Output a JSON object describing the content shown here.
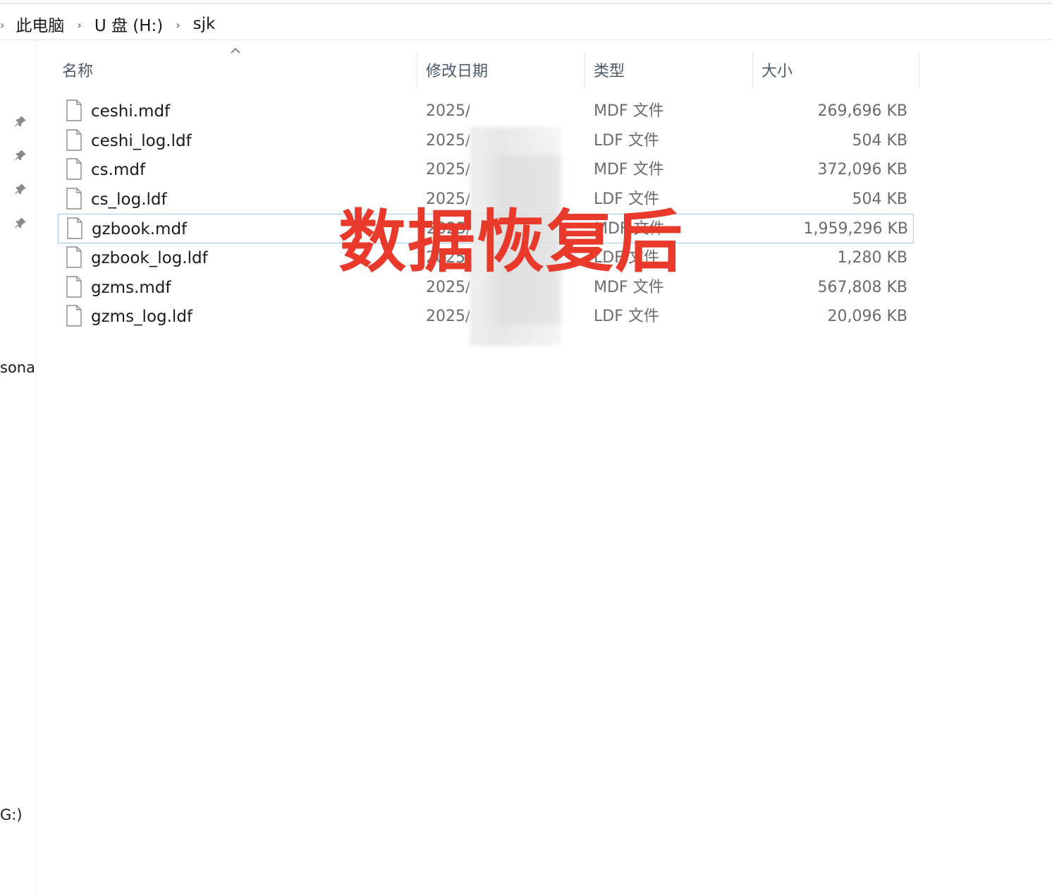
{
  "breadcrumb": {
    "items": [
      "此电脑",
      "U 盘 (H:)",
      "sjk"
    ]
  },
  "nav": {
    "partial_label_1": "sona",
    "partial_label_2": "G:)"
  },
  "columns": {
    "name": "名称",
    "date": "修改日期",
    "type": "类型",
    "size": "大小"
  },
  "files": [
    {
      "name": "ceshi.mdf",
      "date": "2025/",
      "type": "MDF 文件",
      "size": "269,696 KB"
    },
    {
      "name": "ceshi_log.ldf",
      "date": "2025/",
      "type": "LDF 文件",
      "size": "504 KB"
    },
    {
      "name": "cs.mdf",
      "date": "2025/",
      "type": "MDF 文件",
      "size": "372,096 KB"
    },
    {
      "name": "cs_log.ldf",
      "date": "2025/",
      "type": "LDF 文件",
      "size": "504 KB"
    },
    {
      "name": "gzbook.mdf",
      "date": "2025/",
      "type": "MDF 文件",
      "size": "1,959,296 KB"
    },
    {
      "name": "gzbook_log.ldf",
      "date": "2025/",
      "type": "LDF 文件",
      "size": "1,280 KB"
    },
    {
      "name": "gzms.mdf",
      "date": "2025/",
      "type": "MDF 文件",
      "size": "567,808 KB"
    },
    {
      "name": "gzms_log.ldf",
      "date": "2025/",
      "type": "LDF 文件",
      "size": "20,096 KB"
    }
  ],
  "selected_index": 4,
  "watermark": "数据恢复后",
  "colors": {
    "watermark": "#e8392a",
    "selection_border": "#99c9ef",
    "header_text": "#4a5a6a"
  },
  "icons": {
    "file": "blank-file-icon",
    "pin": "pin-icon",
    "sort": "sort-up-icon",
    "chevron": "chevron-right-icon"
  }
}
